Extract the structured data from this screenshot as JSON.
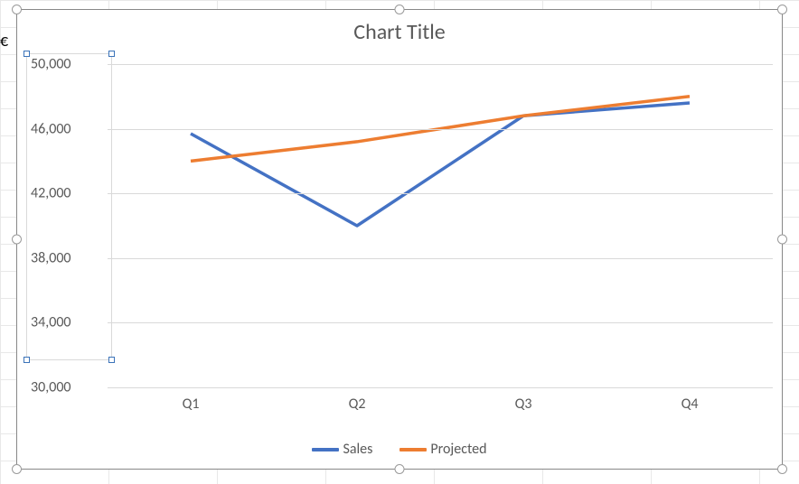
{
  "cell_truncated": "€",
  "chart_data": {
    "type": "line",
    "title": "Chart Title",
    "xlabel": "",
    "ylabel": "",
    "categories": [
      "Q1",
      "Q2",
      "Q3",
      "Q4"
    ],
    "ylim": [
      30000,
      50000
    ],
    "yticks": [
      30000,
      34000,
      38000,
      42000,
      46000,
      50000
    ],
    "ytick_labels": [
      "30,000",
      "34,000",
      "38,000",
      "42,000",
      "46,000",
      "50,000"
    ],
    "series": [
      {
        "name": "Sales",
        "values": [
          45700,
          40000,
          46800,
          47600
        ],
        "color": "#4472C4"
      },
      {
        "name": "Projected",
        "values": [
          44000,
          45200,
          46800,
          48000
        ],
        "color": "#ED7D31"
      }
    ],
    "legend_position": "bottom",
    "grid": true
  }
}
